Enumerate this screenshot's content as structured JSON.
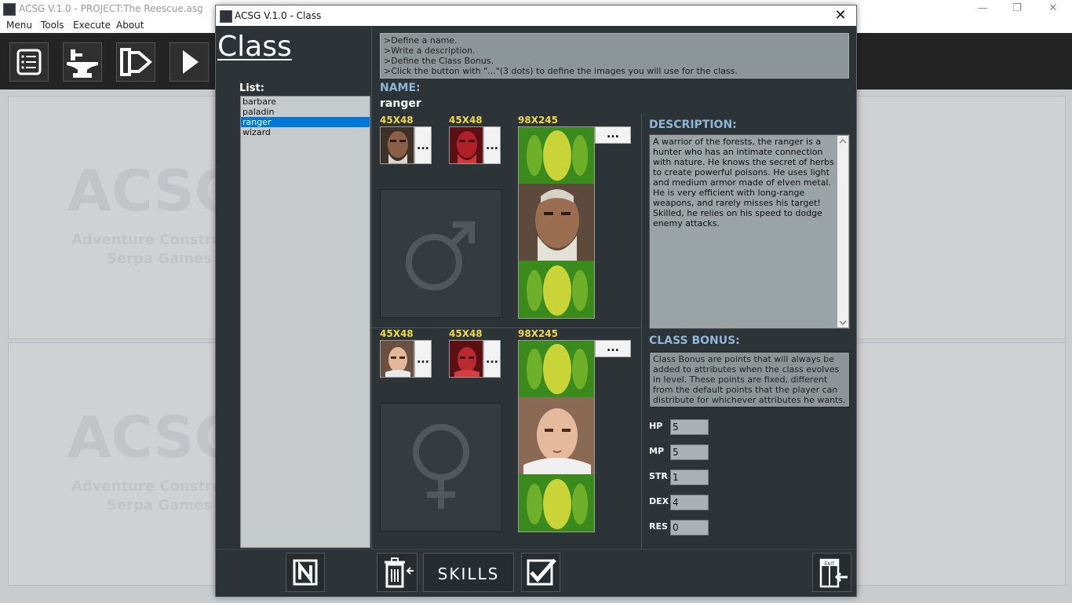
{
  "main_window": {
    "title": "ACSG V.1.0 - PROJECT:The Reescue.asg",
    "controls": {
      "minimize": "—",
      "maximize": "❐",
      "close": "✕"
    },
    "menu": [
      "Menu",
      "Tools",
      "Execute",
      "About"
    ]
  },
  "watermark": {
    "logo": "ACSG",
    "line1": "Adventure Construct",
    "line2": "Serpa Games"
  },
  "dialog": {
    "title": "ACSG V.1.0 - Class",
    "close": "✕",
    "heading": "Class",
    "list_label": "List:",
    "list_items": [
      "barbare",
      "paladin",
      "ranger",
      "wizard"
    ],
    "selected_index": 2,
    "instructions": [
      ">Define a name.",
      ">Write a description.",
      ">Define the Class Bonus.",
      ">Click the button with \"...\"(3 dots) to define the images you will use for the class."
    ],
    "name_label": "NAME:",
    "name_value": "ranger",
    "male": {
      "size1": "45X48",
      "size2": "45X48",
      "size3": "98X245"
    },
    "female": {
      "size1": "45X48",
      "size2": "45X48",
      "size3": "98X245"
    },
    "dots": "...",
    "description_label": "DESCRIPTION:",
    "description": "A warrior of the forests, the ranger is a hunter who has an intimate connection with nature. He knows the secret of herbs to create powerful poisons. He uses light and medium armor made of elven metal. He is very efficient with long-range weapons, and rarely misses his target! Skilled, he relies on his speed to dodge enemy attacks.",
    "bonus_label": "CLASS BONUS:",
    "bonus_text": "Class Bonus are points that will always be added to attributes when the class evolves in level. These points are fixed, different from the default points that the player can distribute for whichever attributes he wants.",
    "stats": [
      {
        "label": "HP",
        "value": "5"
      },
      {
        "label": "MP",
        "value": "5"
      },
      {
        "label": "STR",
        "value": "1"
      },
      {
        "label": "DEX",
        "value": "4"
      },
      {
        "label": "RES",
        "value": "0"
      }
    ],
    "skills_label": "SKILLS",
    "exit_label": "EXIT"
  }
}
